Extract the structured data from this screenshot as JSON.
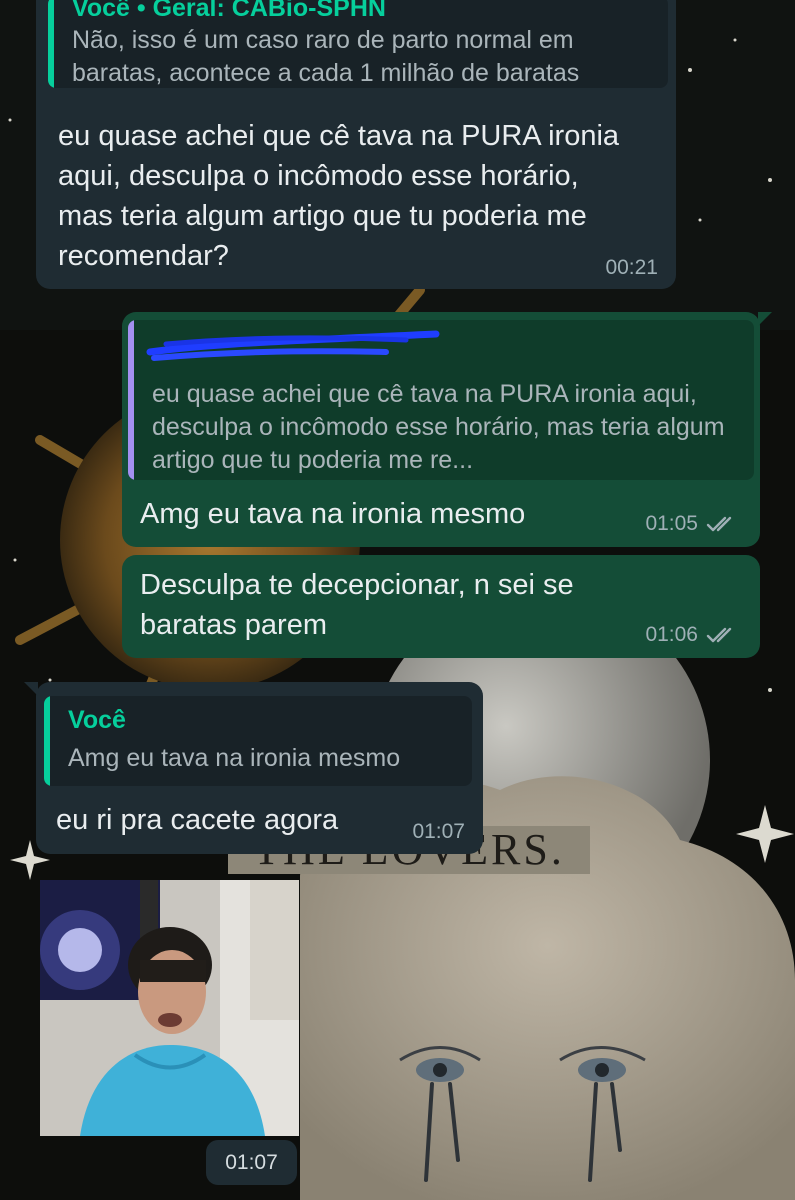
{
  "colors": {
    "incoming_bubble": "#1f2c33",
    "outgoing_bubble": "#144d37",
    "quote_bar_green": "#06cf9c",
    "quote_bar_purple": "#a390f0",
    "read_ticks": "#9fb0b6"
  },
  "wallpaper": {
    "card_caption": "THE LOVERS."
  },
  "messages": [
    {
      "id": "m1",
      "direction": "incoming",
      "quote": {
        "author": "Você",
        "group": "Geral: CABio-SPHN",
        "text": "Não, isso é um caso raro de parto normal em baratas, acontece a cada 1 milhão de baratas"
      },
      "text": "eu quase achei que cê tava na PURA ironia aqui, desculpa o incômodo esse horário, mas teria algum artigo que tu poderia me recomendar?",
      "time": "00:21"
    },
    {
      "id": "m2",
      "direction": "outgoing",
      "quote": {
        "text": "eu quase achei que cê tava na PURA ironia aqui, desculpa o incômodo esse horário, mas teria algum artigo que tu poderia me re..."
      },
      "text": "Amg eu tava na ironia mesmo",
      "time": "01:05",
      "status_icon": "double-check-icon"
    },
    {
      "id": "m3",
      "direction": "outgoing",
      "text": "Desculpa te decepcionar, n sei se baratas parem",
      "time": "01:06",
      "status_icon": "double-check-icon"
    },
    {
      "id": "m4",
      "direction": "incoming",
      "quote": {
        "author": "Você",
        "text": "Amg eu tava na ironia mesmo"
      },
      "text": "eu ri pra cacete agora",
      "time": "01:07"
    },
    {
      "id": "m5",
      "direction": "incoming",
      "type": "image",
      "time": "01:07"
    }
  ]
}
